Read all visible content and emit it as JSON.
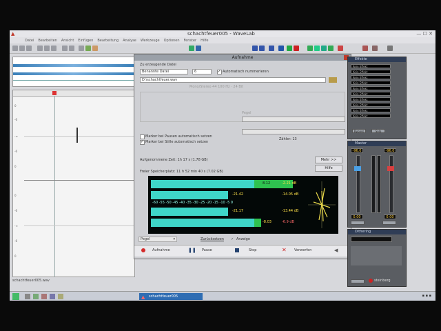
{
  "window": {
    "title": "schachtfeuer005 - WaveLab"
  },
  "menu": [
    "Datei",
    "Bearbeiten",
    "Ansicht",
    "Einfügen",
    "Bearbeitung",
    "Analyse",
    "Werkzeuge",
    "Optionen",
    "Fenster",
    "Hilfe"
  ],
  "wave": {
    "y_labels": [
      "0",
      "-6",
      "-∞",
      "-6",
      "0",
      "0",
      "-6",
      "-∞",
      "-6",
      "0"
    ]
  },
  "status_left": "schachtfeuer005.wav",
  "taskbar": {
    "active_item": "schachtfeuer005"
  },
  "dialog": {
    "title": "Aufnahme",
    "section_file": "Zu erzeugende Datei",
    "name_mode": "Benannte Datei",
    "number": "6",
    "auto_number": "Automatisch nummerieren",
    "file_path": "D:\\schachtfeuer.wav",
    "format_info": "Mono/Stereo 44 100 Hz · 24 Bit",
    "marker_pause": "Marker bei Pausen automatisch setzen",
    "marker_silence": "Marker bei Stille automatisch setzen",
    "pegel_label": "Pegel",
    "zaehler": "Zähler: 13",
    "elapsed": "Aufgenommene Zeit: 1h 17 s (1.78 GB)",
    "free_space": "Freier Speicherplatz: 11 h 52 min 40 s (7.02 GB)",
    "mehr": "Mehr >>",
    "hilfe": "Hilfe",
    "pegel_select": "Pegel",
    "zuruecksetzen": "Zurücksetzen",
    "anzeige": "Anzeige",
    "record_button": "Aufnahme",
    "pause_button": "Pause",
    "stop_button": "Stop",
    "discard_button": "Verwerfen"
  },
  "meter": {
    "top": {
      "peak": "8.12",
      "right": "-2.21 dB"
    },
    "mid1": {
      "left": "-21.42",
      "right": "-14.05 dB"
    },
    "mid2": {
      "left": "-21.17",
      "right": "-13.44 dB"
    },
    "bottom": {
      "peak": "-8.03",
      "right": "-6.9 dB"
    },
    "scale": "-60 -55 -50 -45 -40 -35 -30 -25 -20 -15 -10 -5 0",
    "colors": {
      "cyan": "#3fd6c8",
      "green": "#2fc24f",
      "text_yellow": "#ffe24a",
      "text_red": "#ff6a6a"
    }
  },
  "effects": {
    "title": "Effekte",
    "slots": [
      "Kein Effekt",
      "Kein Effekt",
      "Kein Effekt",
      "Kein Effekt",
      "Kein Effekt",
      "Kein Effekt",
      "Kein Effekt",
      "Kein Effekt",
      "Kein Effekt",
      "Kein Effekt"
    ],
    "b1": "Bypass",
    "b2": "Solo"
  },
  "master": {
    "title": "Master",
    "left_db": "-96.0",
    "right_db": "-96.0",
    "left_out": "0.00",
    "right_out": "0.00"
  },
  "dithering": {
    "title": "Dithering",
    "logo": "steinberg"
  }
}
